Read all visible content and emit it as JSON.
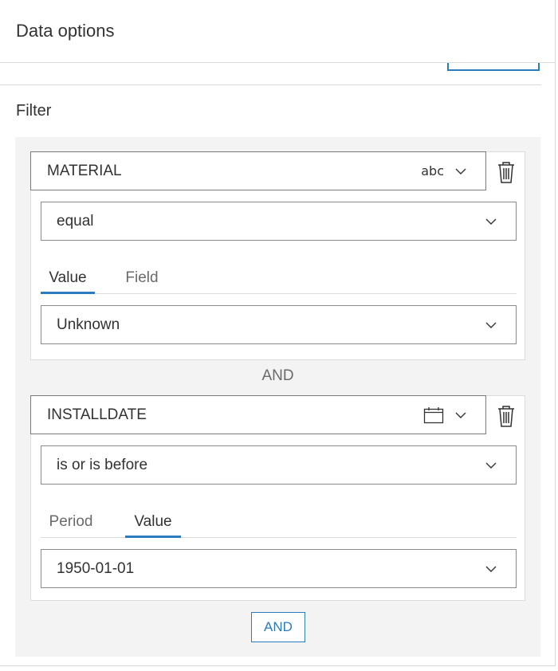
{
  "header": {
    "title": "Data options"
  },
  "filter": {
    "label": "Filter",
    "clauses": [
      {
        "field": "MATERIAL",
        "type_icon": "abc",
        "operator": "equal",
        "tabs": [
          {
            "label": "Value",
            "active": true
          },
          {
            "label": "Field",
            "active": false
          }
        ],
        "value": "Unknown"
      },
      {
        "field": "INSTALLDATE",
        "type_icon": "calendar-icon",
        "operator": "is or is before",
        "tabs": [
          {
            "label": "Period",
            "active": false
          },
          {
            "label": "Value",
            "active": true
          }
        ],
        "value": "1950-01-01"
      }
    ],
    "connector": "AND",
    "add_button": "AND"
  },
  "colors": {
    "accent": "#2a7bbf",
    "panel_bg": "#f3f3f3",
    "text": "#323232",
    "muted": "#6a6a6a"
  }
}
